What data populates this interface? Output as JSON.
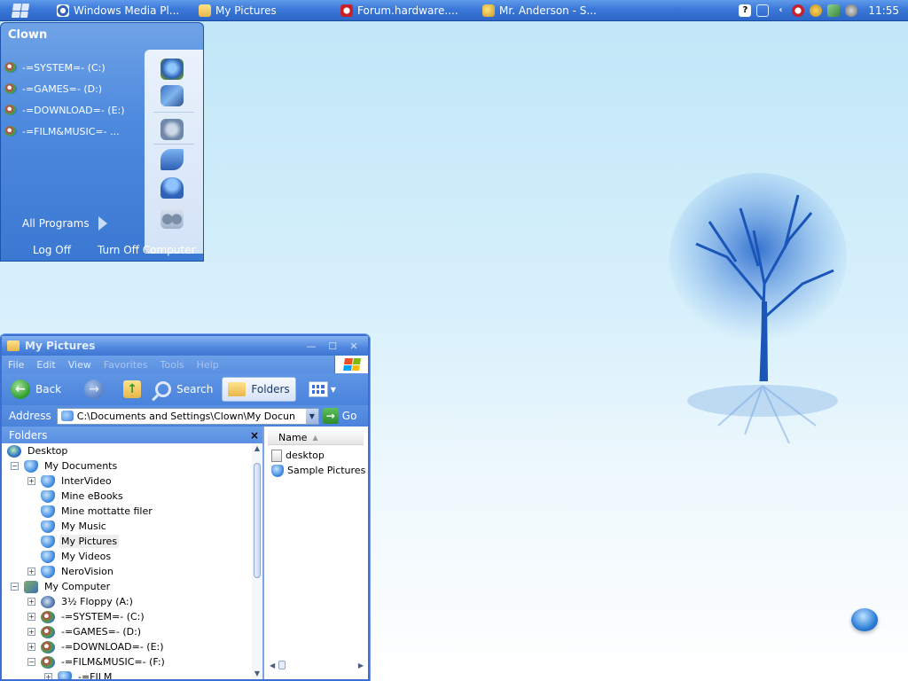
{
  "taskbar": {
    "items": [
      {
        "label": "Windows Media Pl...",
        "icon": "media-player-icon"
      },
      {
        "label": "My Pictures",
        "icon": "folder-icon"
      },
      {
        "label": "Forum.hardware....",
        "icon": "opera-icon"
      },
      {
        "label": "Mr. Anderson - S...",
        "icon": "chat-icon"
      }
    ],
    "tray": {
      "help": "?",
      "clock": "11:55"
    }
  },
  "start_menu": {
    "user": "Clown",
    "drives": [
      {
        "label": "-=SYSTEM=- (C:)"
      },
      {
        "label": "-=GAMES=- (D:)"
      },
      {
        "label": "-=DOWNLOAD=- (E:)"
      },
      {
        "label": "-=FILM&MUSIC=- ..."
      }
    ],
    "all_programs": "All Programs",
    "log_off": "Log Off",
    "turn_off": "Turn Off Computer"
  },
  "window": {
    "title": "My Pictures",
    "menu": [
      "File",
      "Edit",
      "View",
      "Favorites",
      "Tools",
      "Help"
    ],
    "toolbar": {
      "back": "Back",
      "search": "Search",
      "folders": "Folders"
    },
    "address": {
      "label": "Address",
      "value": "C:\\Documents and Settings\\Clown\\My Docun",
      "go": "Go"
    },
    "folders_pane": {
      "title": "Folders",
      "close": "×",
      "tree": [
        {
          "label": "Desktop",
          "level": 0,
          "expander": "",
          "icon": "desktop"
        },
        {
          "label": "My Documents",
          "level": 1,
          "expander": "−",
          "icon": "folder"
        },
        {
          "label": "InterVideo",
          "level": 2,
          "expander": "+",
          "icon": "folder"
        },
        {
          "label": "Mine eBooks",
          "level": 2,
          "expander": "",
          "icon": "folder"
        },
        {
          "label": "Mine mottatte filer",
          "level": 2,
          "expander": "",
          "icon": "folder"
        },
        {
          "label": "My Music",
          "level": 2,
          "expander": "",
          "icon": "folder"
        },
        {
          "label": "My Pictures",
          "level": 2,
          "expander": "",
          "icon": "folder",
          "selected": true
        },
        {
          "label": "My Videos",
          "level": 2,
          "expander": "",
          "icon": "folder"
        },
        {
          "label": "NeroVision",
          "level": 2,
          "expander": "+",
          "icon": "folder"
        },
        {
          "label": "My Computer",
          "level": 1,
          "expander": "−",
          "icon": "computer"
        },
        {
          "label": "3½ Floppy (A:)",
          "level": 2,
          "expander": "+",
          "icon": "floppy"
        },
        {
          "label": "-=SYSTEM=- (C:)",
          "level": 2,
          "expander": "+",
          "icon": "drive"
        },
        {
          "label": "-=GAMES=- (D:)",
          "level": 2,
          "expander": "+",
          "icon": "drive"
        },
        {
          "label": "-=DOWNLOAD=- (E:)",
          "level": 2,
          "expander": "+",
          "icon": "drive"
        },
        {
          "label": "-=FILM&MUSIC=- (F:)",
          "level": 2,
          "expander": "−",
          "icon": "drive"
        },
        {
          "label": "-=FILM",
          "level": 3,
          "expander": "+",
          "icon": "folder"
        }
      ]
    },
    "file_pane": {
      "column": "Name",
      "files": [
        {
          "label": "desktop",
          "icon": "doc"
        },
        {
          "label": "Sample Pictures",
          "icon": "folder"
        }
      ]
    }
  }
}
